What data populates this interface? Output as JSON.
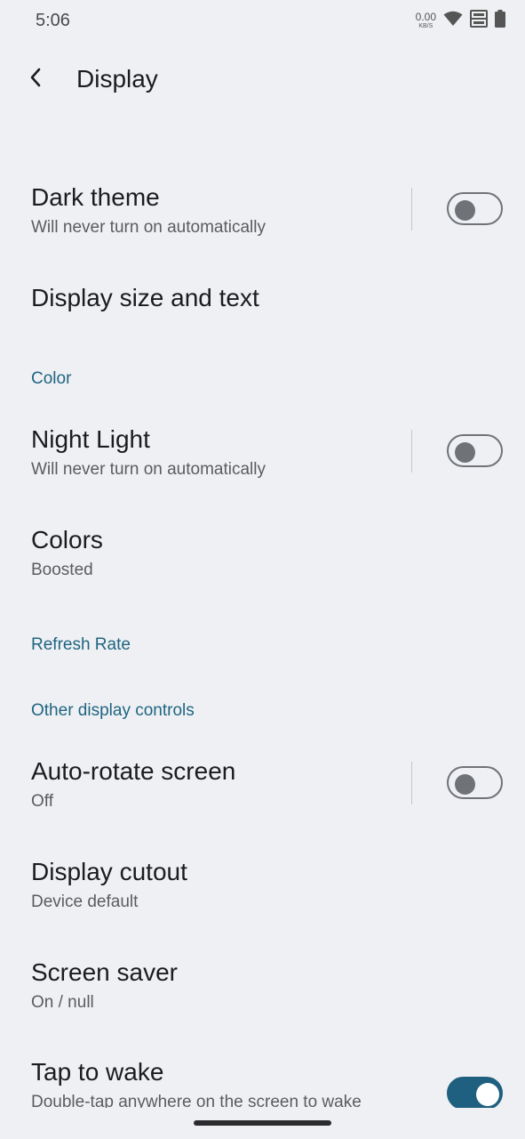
{
  "status_bar": {
    "time": "5:06",
    "net_speed_value": "0.00",
    "net_speed_unit": "KB/S",
    "icons": [
      "wifi-icon",
      "volte-icon",
      "battery-icon"
    ]
  },
  "header": {
    "back_icon": "back-arrow-icon",
    "title": "Display"
  },
  "items": {
    "dark_theme": {
      "title": "Dark theme",
      "subtitle": "Will never turn on automatically",
      "enabled": false
    },
    "display_size": {
      "title": "Display size and text"
    },
    "color_header": "Color",
    "night_light": {
      "title": "Night Light",
      "subtitle": "Will never turn on automatically",
      "enabled": false
    },
    "colors": {
      "title": "Colors",
      "subtitle": "Boosted"
    },
    "refresh_header": "Refresh Rate",
    "other_header": "Other display controls",
    "auto_rotate": {
      "title": "Auto-rotate screen",
      "subtitle": "Off",
      "enabled": false
    },
    "display_cutout": {
      "title": "Display cutout",
      "subtitle": "Device default"
    },
    "screen_saver": {
      "title": "Screen saver",
      "subtitle": "On / null"
    },
    "tap_to_wake": {
      "title": "Tap to wake",
      "subtitle": "Double-tap anywhere on the screen to wake",
      "enabled": true
    }
  },
  "colors": {
    "background": "#eff0f3",
    "accent": "#1f6582",
    "switch_on": "#1f5f7f",
    "switch_off": "#6f7377"
  }
}
